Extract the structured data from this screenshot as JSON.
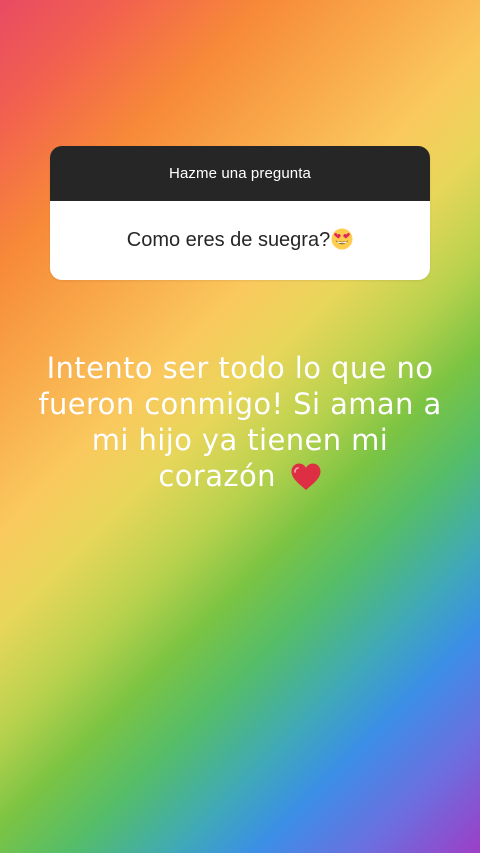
{
  "colors": {
    "card_header_bg": "#262626",
    "card_body_bg": "#ffffff",
    "card_text": "#262626",
    "caption_text": "#ffffff"
  },
  "question_sticker": {
    "header": "Hazme una pregunta",
    "question": "Como eres de suegra?",
    "question_emoji": "heart-eyes-icon"
  },
  "caption": {
    "text": "Intento ser todo lo que no fueron conmigo! Si aman a mi hijo ya tienen mi corazón",
    "emoji": "heart-icon"
  }
}
